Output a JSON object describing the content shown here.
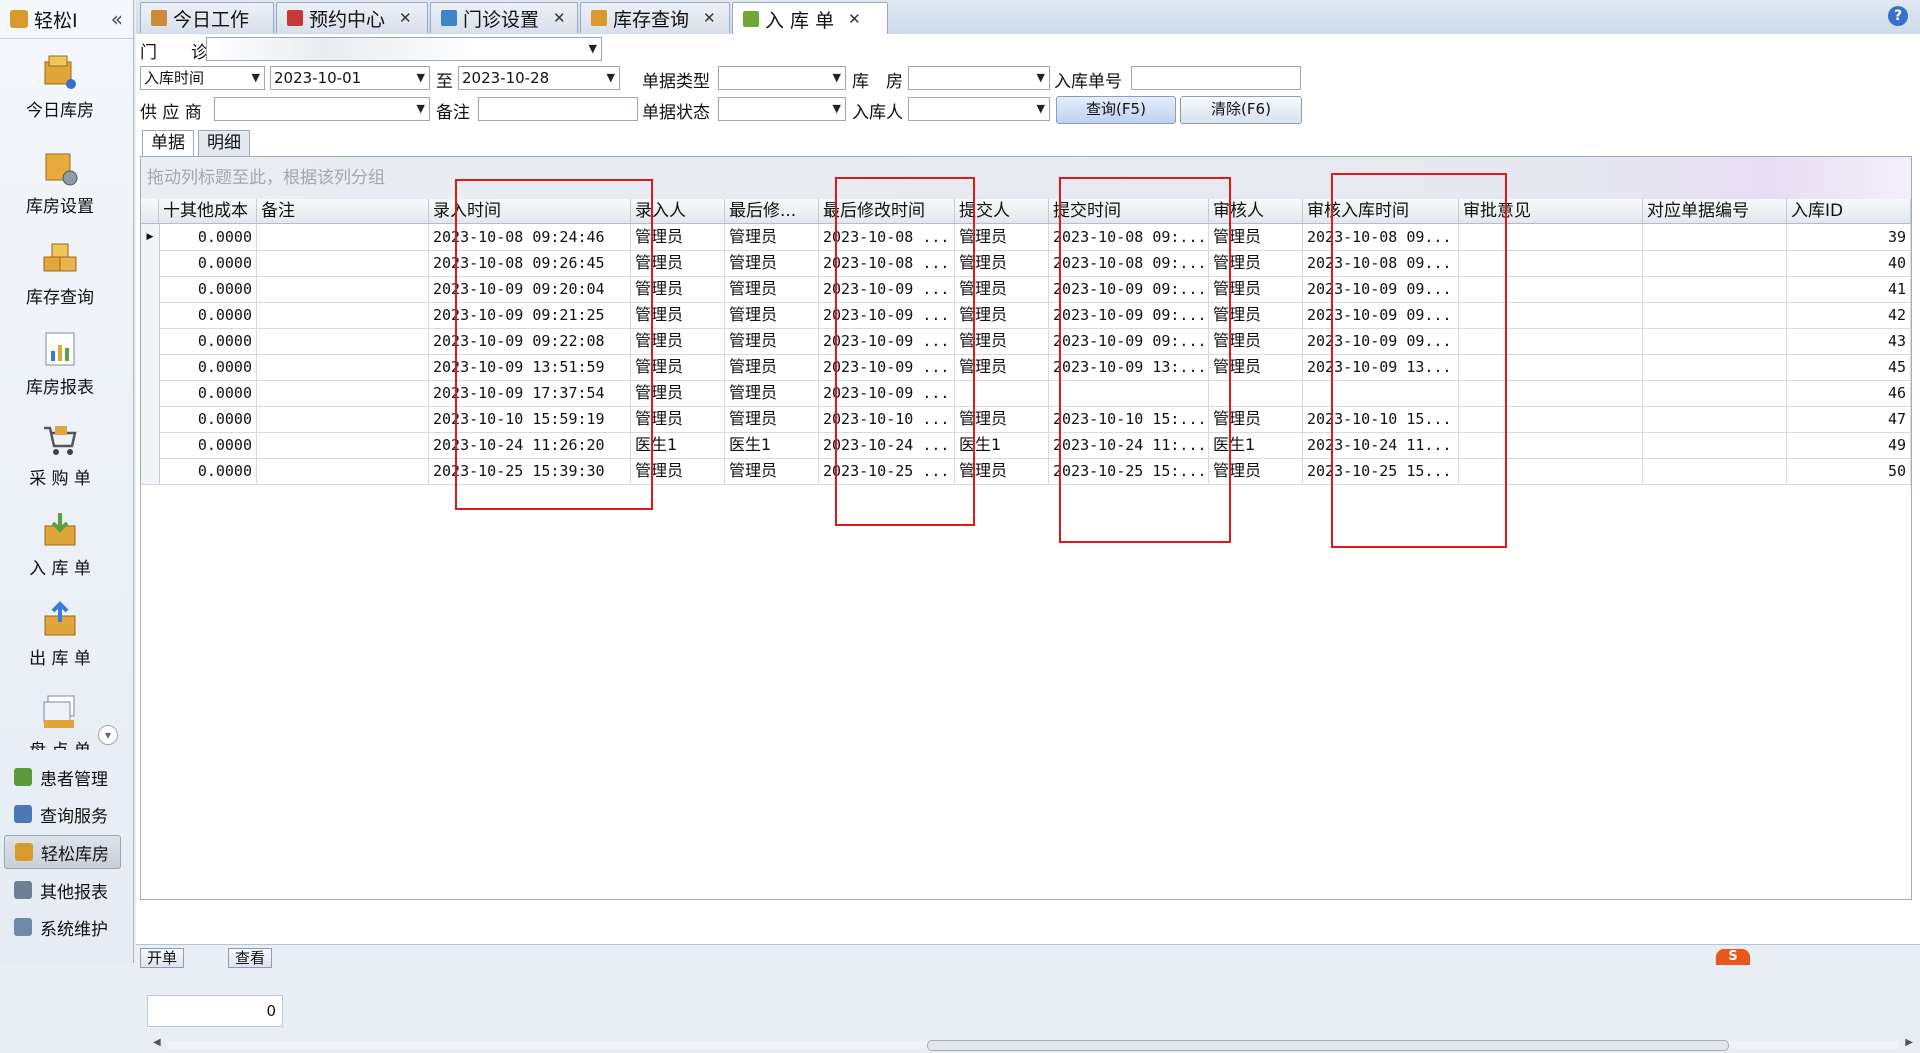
{
  "sidebar": {
    "title": "轻松I",
    "nav_items": [
      {
        "label": "今日库房",
        "icon": "warehouse-today-icon"
      },
      {
        "label": "库房设置",
        "icon": "warehouse-settings-icon"
      },
      {
        "label": "库存查询",
        "icon": "inventory-search-icon"
      },
      {
        "label": "库房报表",
        "icon": "report-icon"
      },
      {
        "label": "采 购 单",
        "icon": "shopping-cart-icon"
      },
      {
        "label": "入 库 单",
        "icon": "inbound-box-icon"
      },
      {
        "label": "出 库 单",
        "icon": "outbound-box-icon"
      },
      {
        "label": "盘 点 单",
        "icon": "stocktake-icon"
      }
    ],
    "sections": [
      {
        "label": "患者管理",
        "icon": "patients-icon",
        "color": "#5a9b3c"
      },
      {
        "label": "查询服务",
        "icon": "query-icon",
        "color": "#4d78b8"
      },
      {
        "label": "轻松库房",
        "icon": "box-icon",
        "color": "#d79b2c"
      },
      {
        "label": "其他报表",
        "icon": "report-icon",
        "color": "#6f7f95"
      },
      {
        "label": "系统维护",
        "icon": "settings-icon",
        "color": "#6f8aa8"
      }
    ]
  },
  "tabs": [
    {
      "label": "今日工作",
      "icon": "person-icon",
      "color": "#c98a3a"
    },
    {
      "label": "预约中心",
      "icon": "calendar-icon",
      "color": "#c73838"
    },
    {
      "label": "门诊设置",
      "icon": "home-icon",
      "color": "#3f83c9"
    },
    {
      "label": "库存查询",
      "icon": "box-icon",
      "color": "#d79b2c"
    },
    {
      "label": "入 库 单",
      "icon": "inbound-icon",
      "color": "#6da838"
    }
  ],
  "filters": {
    "clinic_label": "门　　诊",
    "date_type": "入库时间",
    "date_from": "2023-10-01",
    "to_label": "至",
    "date_to": "2023-10-28",
    "doc_type_label": "单据类型",
    "warehouse_label": "库　房",
    "doc_no_label": "入库单号",
    "supplier_label": "供 应 商",
    "remark_label": "备注",
    "status_label": "单据状态",
    "receiver_label": "入库人",
    "query_button": "查询(F5)",
    "clear_button": "清除(F6)"
  },
  "sub_tabs": [
    "单据",
    "明细"
  ],
  "grid": {
    "group_hint": "拖动列标题至此，根据该列分组",
    "columns": [
      "十其他成本",
      "备注",
      "录入时间",
      "录入人",
      "最后修...",
      "最后修改时间",
      "提交人",
      "提交时间",
      "审核人",
      "审核入库时间",
      "审批意见",
      "对应单据编号",
      "入库ID"
    ],
    "rows": [
      [
        "0.0000",
        "",
        "2023-10-08 09:24:46",
        "管理员",
        "管理员",
        "2023-10-08 ...",
        "管理员",
        "2023-10-08 09:...",
        "管理员",
        "2023-10-08 09...",
        "",
        "",
        "39"
      ],
      [
        "0.0000",
        "",
        "2023-10-08 09:26:45",
        "管理员",
        "管理员",
        "2023-10-08 ...",
        "管理员",
        "2023-10-08 09:...",
        "管理员",
        "2023-10-08 09...",
        "",
        "",
        "40"
      ],
      [
        "0.0000",
        "",
        "2023-10-09 09:20:04",
        "管理员",
        "管理员",
        "2023-10-09 ...",
        "管理员",
        "2023-10-09 09:...",
        "管理员",
        "2023-10-09 09...",
        "",
        "",
        "41"
      ],
      [
        "0.0000",
        "",
        "2023-10-09 09:21:25",
        "管理员",
        "管理员",
        "2023-10-09 ...",
        "管理员",
        "2023-10-09 09:...",
        "管理员",
        "2023-10-09 09...",
        "",
        "",
        "42"
      ],
      [
        "0.0000",
        "",
        "2023-10-09 09:22:08",
        "管理员",
        "管理员",
        "2023-10-09 ...",
        "管理员",
        "2023-10-09 09:...",
        "管理员",
        "2023-10-09 09...",
        "",
        "",
        "43"
      ],
      [
        "0.0000",
        "",
        "2023-10-09 13:51:59",
        "管理员",
        "管理员",
        "2023-10-09 ...",
        "管理员",
        "2023-10-09 13:...",
        "管理员",
        "2023-10-09 13...",
        "",
        "",
        "45"
      ],
      [
        "0.0000",
        "",
        "2023-10-09 17:37:54",
        "管理员",
        "管理员",
        "2023-10-09 ...",
        "",
        "",
        "",
        "",
        "",
        "",
        "46"
      ],
      [
        "0.0000",
        "",
        "2023-10-10 15:59:19",
        "管理员",
        "管理员",
        "2023-10-10 ...",
        "管理员",
        "2023-10-10 15:...",
        "管理员",
        "2023-10-10 15...",
        "",
        "",
        "47"
      ],
      [
        "0.0000",
        "",
        "2023-10-24 11:26:20",
        "医生1",
        "医生1",
        "2023-10-24 ...",
        "医生1",
        "2023-10-24 11:...",
        "医生1",
        "2023-10-24 11...",
        "",
        "",
        "49"
      ],
      [
        "0.0000",
        "",
        "2023-10-25 15:39:30",
        "管理员",
        "管理员",
        "2023-10-25 ...",
        "管理员",
        "2023-10-25 15:...",
        "管理员",
        "2023-10-25 15...",
        "",
        "",
        "50"
      ]
    ],
    "footer_total": "0"
  },
  "bottom": {
    "buttons": [
      "开单",
      "查看"
    ]
  }
}
